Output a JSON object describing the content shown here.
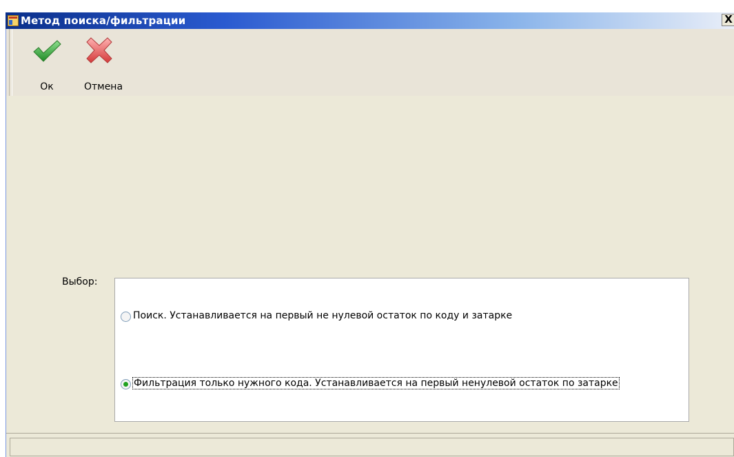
{
  "window": {
    "title": "Метод поиска/фильтрации",
    "close_label": "X"
  },
  "toolbar": {
    "ok_label": "Ок",
    "cancel_label": "Отмена",
    "ok_icon": "checkmark-icon",
    "cancel_icon": "red-x-icon",
    "ok_color": "#3aa83a",
    "cancel_color": "#e05050"
  },
  "form": {
    "choice_label": "Выбор:",
    "options": [
      {
        "label": "Поиск. Устанавливается на первый не нулевой остаток по коду и затарке",
        "selected": false
      },
      {
        "label": "Фильтрация только нужного кода. Устанавливается на первый ненулевой остаток по затарке",
        "selected": true
      }
    ]
  },
  "statusbar": {
    "text": ""
  }
}
